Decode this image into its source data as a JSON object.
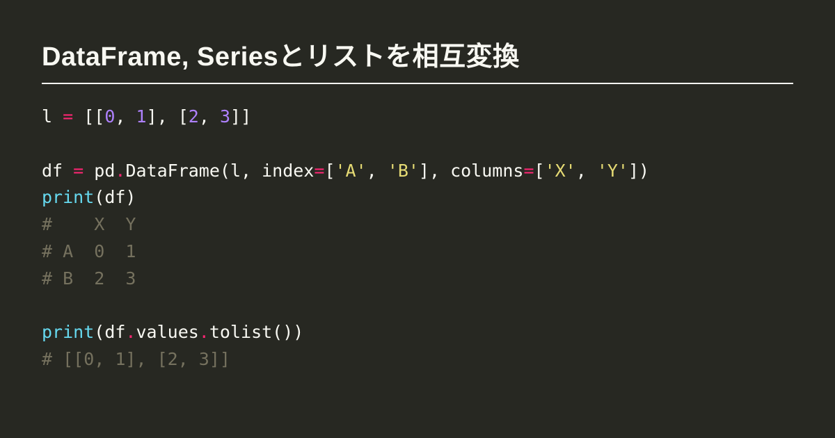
{
  "title": "DataFrame, Seriesとリストを相互変換",
  "code": {
    "tokens": [
      [
        [
          "l ",
          "fg"
        ],
        [
          "=",
          "op"
        ],
        [
          " [[",
          "fg"
        ],
        [
          "0",
          "num"
        ],
        [
          ", ",
          "fg"
        ],
        [
          "1",
          "num"
        ],
        [
          "], [",
          "fg"
        ],
        [
          "2",
          "num"
        ],
        [
          ", ",
          "fg"
        ],
        [
          "3",
          "num"
        ],
        [
          "]]",
          "fg"
        ]
      ],
      [],
      [
        [
          "df ",
          "fg"
        ],
        [
          "=",
          "op"
        ],
        [
          " pd",
          "fg"
        ],
        [
          ".",
          "op"
        ],
        [
          "DataFrame(l, index",
          "fg"
        ],
        [
          "=",
          "op"
        ],
        [
          "[",
          "fg"
        ],
        [
          "'A'",
          "str"
        ],
        [
          ", ",
          "fg"
        ],
        [
          "'B'",
          "str"
        ],
        [
          "], columns",
          "fg"
        ],
        [
          "=",
          "op"
        ],
        [
          "[",
          "fg"
        ],
        [
          "'X'",
          "str"
        ],
        [
          ", ",
          "fg"
        ],
        [
          "'Y'",
          "str"
        ],
        [
          "])",
          "fg"
        ]
      ],
      [
        [
          "print",
          "fn"
        ],
        [
          "(df)",
          "fg"
        ]
      ],
      [
        [
          "#    X  Y",
          "com"
        ]
      ],
      [
        [
          "# A  0  1",
          "com"
        ]
      ],
      [
        [
          "# B  2  3",
          "com"
        ]
      ],
      [],
      [
        [
          "print",
          "fn"
        ],
        [
          "(df",
          "fg"
        ],
        [
          ".",
          "op"
        ],
        [
          "values",
          "fg"
        ],
        [
          ".",
          "op"
        ],
        [
          "tolist())",
          "fg"
        ]
      ],
      [
        [
          "# [[0, 1], [2, 3]]",
          "com"
        ]
      ]
    ]
  }
}
